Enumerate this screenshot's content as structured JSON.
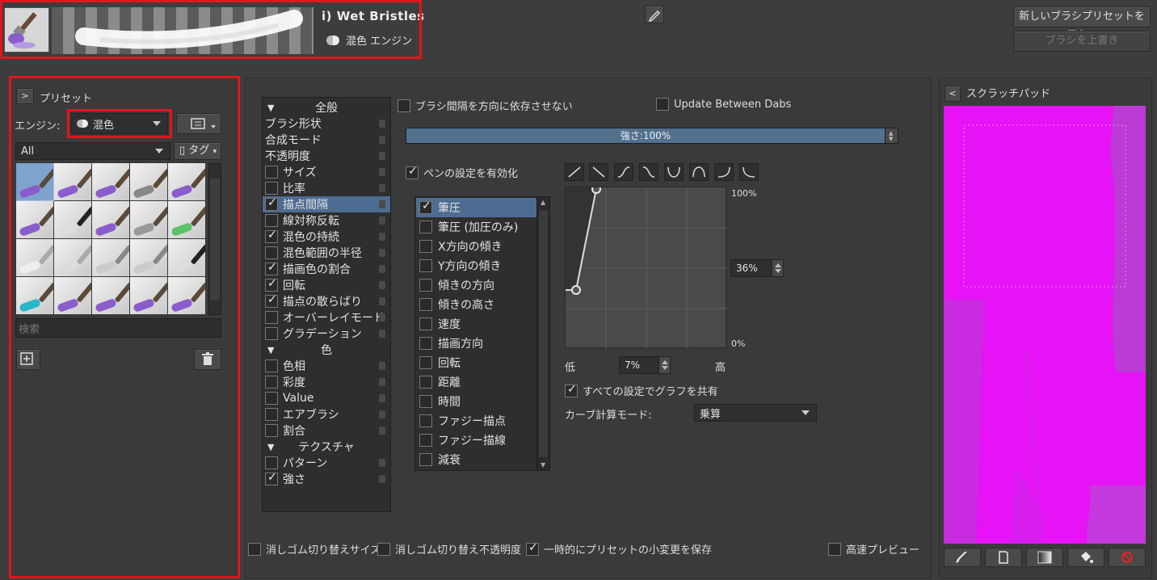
{
  "header": {
    "preset_name": "i) Wet Bristles",
    "engine_name": "混色 エンジン",
    "save_new_label": "新しいブラシプリセットを保存...",
    "overwrite_label": "ブラシを上書き"
  },
  "presets": {
    "title": "プリセット",
    "engine_label": "エンジン:",
    "engine_value": "混色",
    "filter_value": "All",
    "tag_label": "タグ",
    "search_placeholder": "検索"
  },
  "options": {
    "sections": [
      {
        "title": "全般",
        "items": [
          {
            "label": "ブラシ形状",
            "checkbox": false,
            "checked": false,
            "selected": false
          },
          {
            "label": "合成モード",
            "checkbox": false,
            "checked": false,
            "selected": false
          },
          {
            "label": "不透明度",
            "checkbox": false,
            "checked": false,
            "selected": false
          },
          {
            "label": "サイズ",
            "checkbox": true,
            "checked": false,
            "selected": false
          },
          {
            "label": "比率",
            "checkbox": true,
            "checked": false,
            "selected": false
          },
          {
            "label": "描点間隔",
            "checkbox": true,
            "checked": true,
            "selected": true
          },
          {
            "label": "線対称反転",
            "checkbox": true,
            "checked": false,
            "selected": false
          },
          {
            "label": "混色の持続",
            "checkbox": true,
            "checked": true,
            "selected": false
          },
          {
            "label": "混色範囲の半径",
            "checkbox": true,
            "checked": false,
            "selected": false
          },
          {
            "label": "描画色の割合",
            "checkbox": true,
            "checked": true,
            "selected": false
          },
          {
            "label": "回転",
            "checkbox": true,
            "checked": true,
            "selected": false
          },
          {
            "label": "描点の散らばり",
            "checkbox": true,
            "checked": true,
            "selected": false
          },
          {
            "label": "オーバーレイモード",
            "checkbox": true,
            "checked": false,
            "selected": false
          },
          {
            "label": "グラデーション",
            "checkbox": true,
            "checked": false,
            "selected": false
          }
        ]
      },
      {
        "title": "色",
        "items": [
          {
            "label": "色相",
            "checkbox": true,
            "checked": false,
            "selected": false
          },
          {
            "label": "彩度",
            "checkbox": true,
            "checked": false,
            "selected": false
          },
          {
            "label": "Value",
            "checkbox": true,
            "checked": false,
            "selected": false
          },
          {
            "label": "エアブラシ",
            "checkbox": true,
            "checked": false,
            "selected": false
          },
          {
            "label": "割合",
            "checkbox": true,
            "checked": false,
            "selected": false
          }
        ]
      },
      {
        "title": "テクスチャ",
        "items": [
          {
            "label": "パターン",
            "checkbox": true,
            "checked": false,
            "selected": false
          },
          {
            "label": "強さ",
            "checkbox": true,
            "checked": true,
            "selected": false
          }
        ]
      }
    ]
  },
  "spacing": {
    "no_direction_label": "ブラシ間隔を方向に依存させない",
    "update_between_dabs_label": "Update Between Dabs",
    "strength_label": "強さ:100%",
    "strength_percent": 100,
    "enable_pen_label": "ペンの設定を有効化"
  },
  "sensors": [
    {
      "label": "筆圧",
      "checked": true,
      "selected": true
    },
    {
      "label": "筆圧 (加圧のみ)",
      "checked": false,
      "selected": false
    },
    {
      "label": "X方向の傾き",
      "checked": false,
      "selected": false
    },
    {
      "label": "Y方向の傾き",
      "checked": false,
      "selected": false
    },
    {
      "label": "傾きの方向",
      "checked": false,
      "selected": false
    },
    {
      "label": "傾きの高さ",
      "checked": false,
      "selected": false
    },
    {
      "label": "速度",
      "checked": false,
      "selected": false
    },
    {
      "label": "描画方向",
      "checked": false,
      "selected": false
    },
    {
      "label": "回転",
      "checked": false,
      "selected": false
    },
    {
      "label": "距離",
      "checked": false,
      "selected": false
    },
    {
      "label": "時間",
      "checked": false,
      "selected": false
    },
    {
      "label": "ファジー描点",
      "checked": false,
      "selected": false
    },
    {
      "label": "ファジー描線",
      "checked": false,
      "selected": false
    },
    {
      "label": "減衰",
      "checked": false,
      "selected": false
    }
  ],
  "curve": {
    "max_label": "100%",
    "min_label": "0%",
    "y_value": "36%",
    "x_value": "7%",
    "low_label": "低",
    "high_label": "高",
    "share_label": "すべての設定でグラフを共有",
    "mode_label": "カーブ計算モード:",
    "mode_value": "乗算"
  },
  "footer": {
    "eraser_size_label": "消しゴム切り替えサイズ",
    "eraser_opacity_label": "消しゴム切り替え不透明度",
    "save_temp_label": "一時的にプリセットの小変更を保存",
    "fast_preview_label": "高速プレビュー"
  },
  "scratchpad": {
    "title": "スクラッチパッド",
    "fill_color": "#e513f5"
  }
}
